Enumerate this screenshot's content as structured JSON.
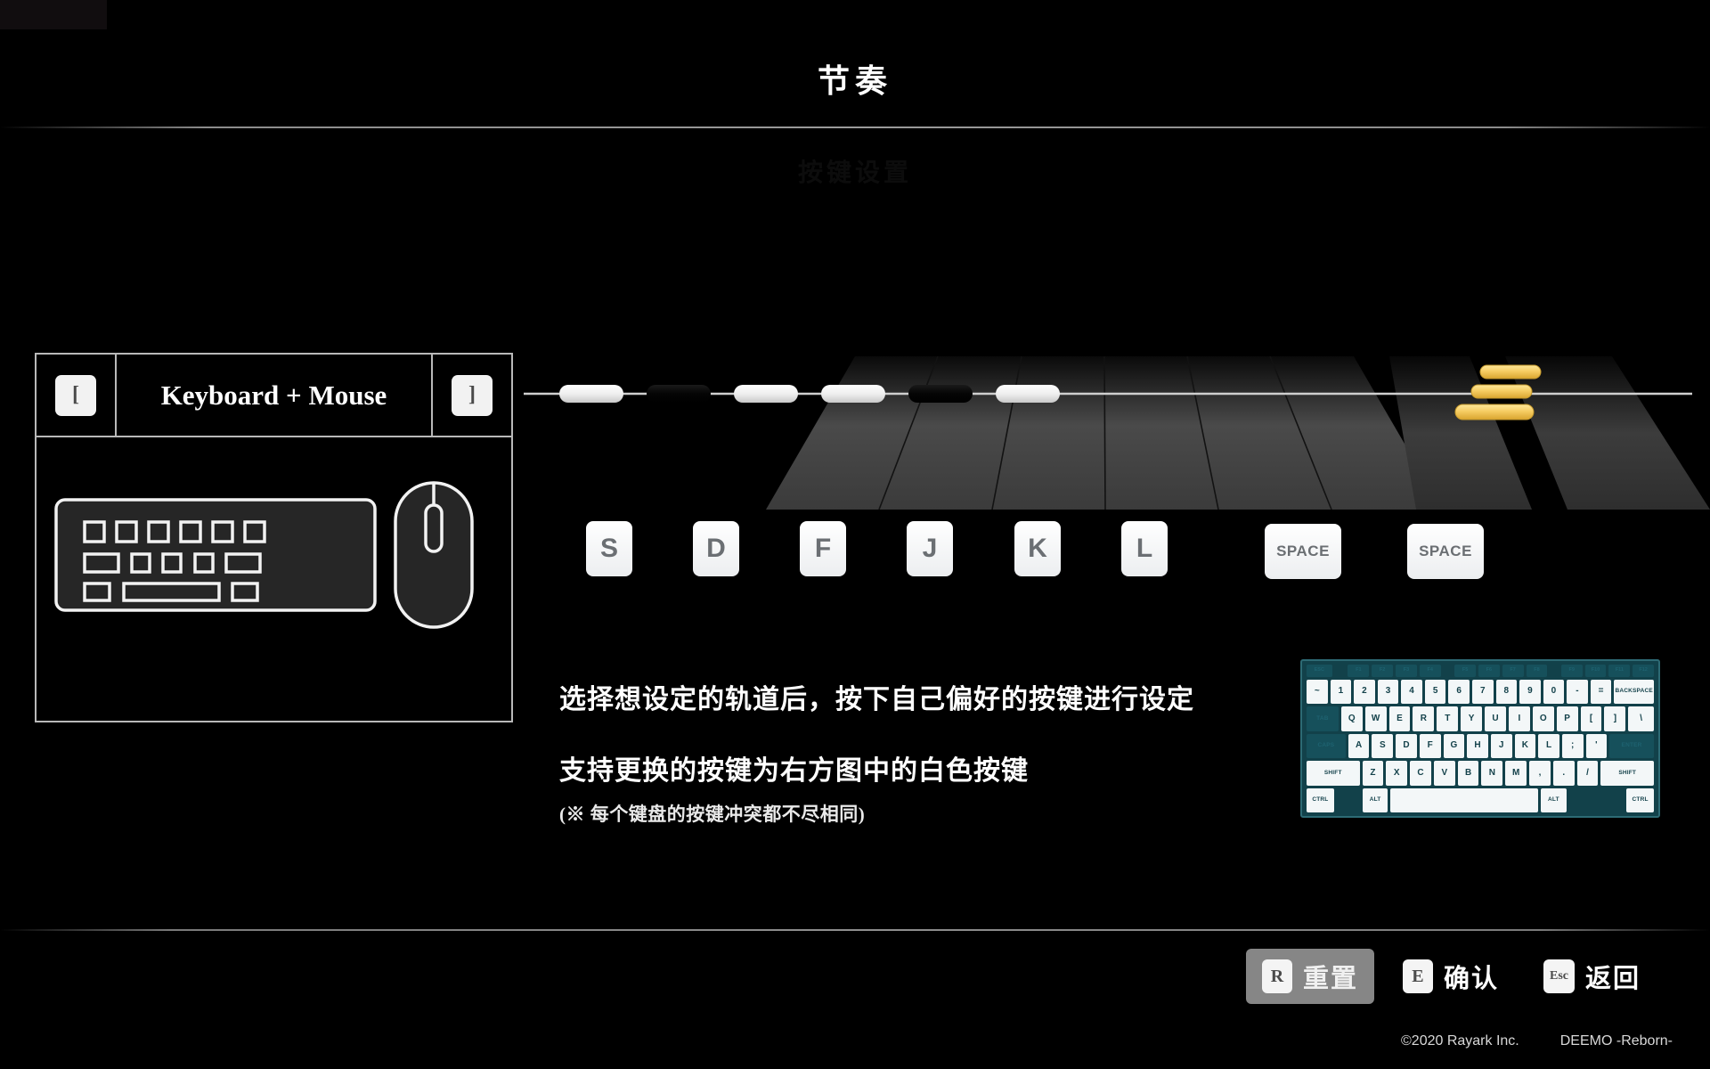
{
  "header": {
    "title": "节奏",
    "ghost_subtitle": "按键设置"
  },
  "device_panel": {
    "prev_key": "[",
    "next_key": "]",
    "device_name": "Keyboard + Mouse",
    "keyboard_icon": "keyboard-icon",
    "mouse_icon": "mouse-icon"
  },
  "stage": {
    "lanes": [
      {
        "key": "S",
        "selected": false
      },
      {
        "key": "D",
        "selected": true
      },
      {
        "key": "F",
        "selected": false
      },
      {
        "key": "J",
        "selected": false
      },
      {
        "key": "K",
        "selected": true
      },
      {
        "key": "L",
        "selected": false
      },
      {
        "key": "SPACE",
        "selected": false
      },
      {
        "key": "SPACE",
        "selected": false
      }
    ],
    "note_color": "#f5cf6b",
    "judgement_line_color": "#cfcfcf"
  },
  "instructions": {
    "line1": "选择想设定的轨道后，按下自己偏好的按键进行设定",
    "line2": "支持更换的按键为右方图中的白色按键",
    "line3": "(※ 每个键盘的按键冲突都不尽相同)"
  },
  "mini_keyboard": {
    "body_color": "#12414a",
    "active_key_color": "#f3f7f8",
    "disabled_key_color": "#16505b",
    "rows": {
      "fn": [
        "ESC",
        "F1",
        "F2",
        "F3",
        "F4",
        "F5",
        "F6",
        "F7",
        "F8",
        "F9",
        "F10",
        "F11",
        "F12"
      ],
      "num": [
        "~",
        "1",
        "2",
        "3",
        "4",
        "5",
        "6",
        "7",
        "8",
        "9",
        "0",
        "-",
        "=",
        "BACKSPACE"
      ],
      "q": [
        "TAB",
        "Q",
        "W",
        "E",
        "R",
        "T",
        "Y",
        "U",
        "I",
        "O",
        "P",
        "[",
        "]",
        "\\"
      ],
      "a": [
        "CAPS",
        "A",
        "S",
        "D",
        "F",
        "G",
        "H",
        "J",
        "K",
        "L",
        ";",
        "'",
        "ENTER"
      ],
      "z": [
        "SHIFT",
        "Z",
        "X",
        "C",
        "V",
        "B",
        "N",
        "M",
        ",",
        ".",
        "/",
        "SHIFT"
      ],
      "sp": [
        "CTRL",
        "ALT",
        "",
        "ALT",
        "CTRL"
      ]
    }
  },
  "actions": [
    {
      "key": "R",
      "label": "重置",
      "active": true
    },
    {
      "key": "E",
      "label": "确认",
      "active": false
    },
    {
      "key": "Esc",
      "label": "返回",
      "active": false
    }
  ],
  "footer": {
    "copyright": "©2020 Rayark Inc.",
    "product": "DEEMO -Reborn-"
  }
}
